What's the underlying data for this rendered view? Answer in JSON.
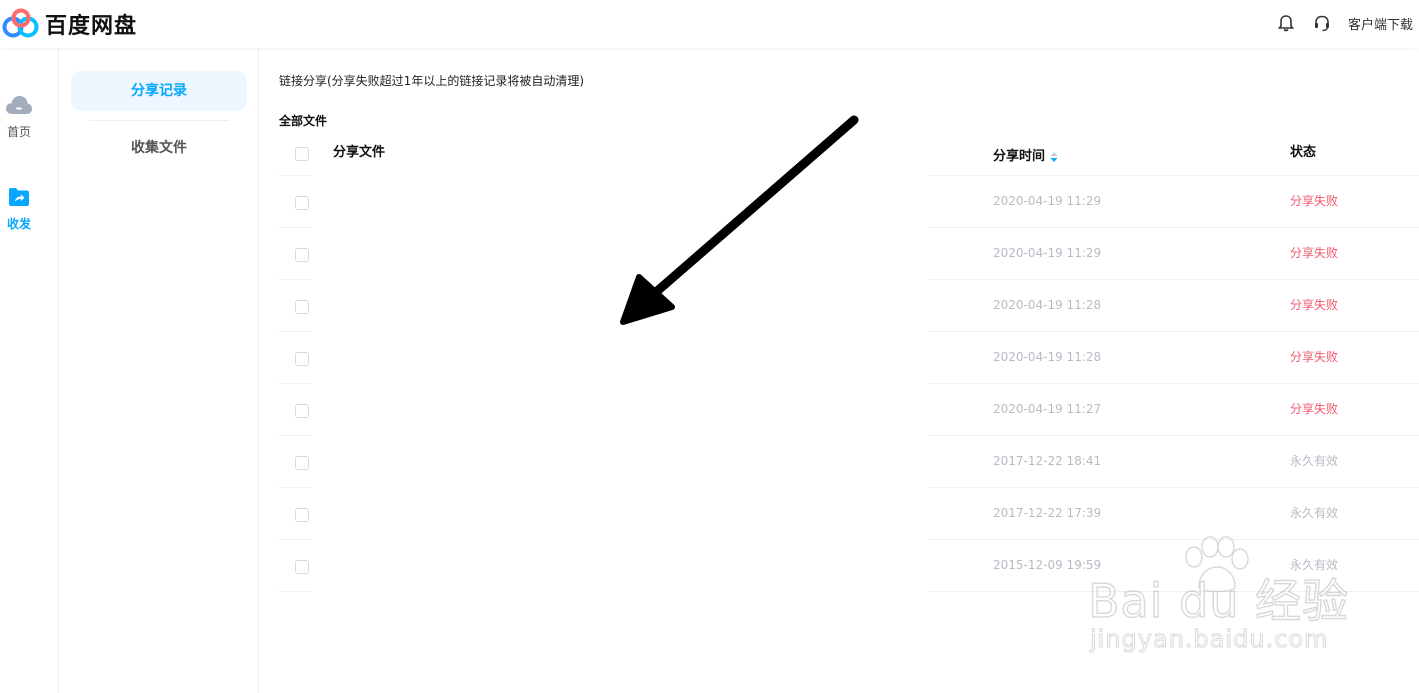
{
  "header": {
    "app_name": "百度网盘",
    "download_label": "客户端下载",
    "icons": [
      "bell-icon",
      "headset-icon"
    ]
  },
  "rail": {
    "items": [
      {
        "label": "首页",
        "icon": "cloud-icon",
        "active": false
      },
      {
        "label": "收发",
        "icon": "share-folder-icon",
        "active": true
      }
    ]
  },
  "submenu": {
    "items": [
      {
        "label": "分享记录",
        "active": true
      },
      {
        "label": "收集文件",
        "active": false
      }
    ]
  },
  "main": {
    "notice": "链接分享(分享失败超过1年以上的链接记录将被自动清理)",
    "section_title": "全部文件",
    "columns": {
      "file": "分享文件",
      "time": "分享时间",
      "status": "状态"
    },
    "rows": [
      {
        "time": "2020-04-19 11:29",
        "status": "分享失败",
        "status_type": "fail"
      },
      {
        "time": "2020-04-19 11:29",
        "status": "分享失败",
        "status_type": "fail"
      },
      {
        "time": "2020-04-19 11:28",
        "status": "分享失败",
        "status_type": "fail"
      },
      {
        "time": "2020-04-19 11:28",
        "status": "分享失败",
        "status_type": "fail"
      },
      {
        "time": "2020-04-19 11:27",
        "status": "分享失败",
        "status_type": "fail"
      },
      {
        "time": "2017-12-22 18:41",
        "status": "永久有效",
        "status_type": "ok"
      },
      {
        "time": "2017-12-22 17:39",
        "status": "永久有效",
        "status_type": "ok"
      },
      {
        "time": "2015-12-09 19:59",
        "status": "永久有效",
        "status_type": "ok"
      }
    ]
  },
  "watermark": {
    "main": "Bai du 经验",
    "sub": "jingyan.baidu.com"
  },
  "colors": {
    "accent": "#06a7ff",
    "fail": "#f05a6e",
    "muted": "#b7bcc4"
  }
}
